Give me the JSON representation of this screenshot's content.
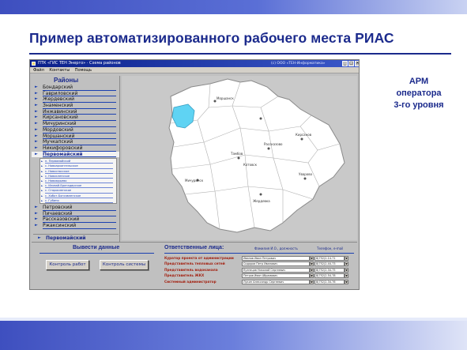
{
  "slide": {
    "title": "Пример автоматизированного рабочего места РИАС",
    "side_note": [
      "АРМ",
      "оператора",
      "3-го уровня"
    ]
  },
  "window": {
    "title": "ПТК «ГИС ТЕН Энерго» · Схема районов",
    "title_right": "(c) ООО «ТЕН-Информатика»",
    "menu": [
      "Файл",
      "Контакты",
      "Помощь"
    ]
  },
  "districts": {
    "heading": "Районы",
    "items": [
      "Бондарский",
      "Гавриловский",
      "Жердевский",
      "Знаменский",
      "Инжавинский",
      "Кирсановский",
      "Мичуринский",
      "Мордовский",
      "Моршанский",
      "Мучкапский",
      "Никифоровский",
      "Первомайский"
    ],
    "selected_index": 11,
    "sub_items": [
      "п. Первомайский",
      "с. Новоархангельское",
      "с. Новоспасское",
      "с. Новокленское",
      "с. Новоюрьево",
      "с. Иловай-Бригадирское",
      "с. Старокленское",
      "с. Хобот-Богоявленское",
      "с. Губино"
    ],
    "items_after": [
      "Петровский",
      "Пичаевский",
      "Рассказовский",
      "Ржаксинский"
    ],
    "current": "Первомайский"
  },
  "map": {
    "labels": [
      "Моршанск",
      "Мичуринск",
      "Тамбов",
      "Котовск",
      "Рассказово",
      "Уварово",
      "Кирсанов",
      "Жердевка"
    ],
    "highlight_color": "#5fd3f3",
    "fill_color": "#ffffff",
    "border_color": "#8a8a8a",
    "background_color": "#c9c9c9"
  },
  "output": {
    "title": "Вывести данные",
    "btn_work": "Контроль работ",
    "btn_system": "Контроль системы"
  },
  "responsible": {
    "title": "Ответственные лица:",
    "col_fio": "Фамилия И.О., должность",
    "col_tel": "Телефон, e-mail",
    "rows": [
      {
        "role": "Куратор проекта от администрации",
        "name": "Иванов Иван Петрович",
        "phone": "8(752)2-14-71"
      },
      {
        "role": "Представитель тепловых сетей",
        "name": "Сидоров Петр Иванович",
        "phone": "8(752)2-44-73"
      },
      {
        "role": "Представитель водоканала",
        "name": "Кузнецов Николай Сергеевич",
        "phone": "8(752)2-34-75"
      },
      {
        "role": "Представитель ЖКХ",
        "name": "Петров Иван Абрамович",
        "phone": "8(752)2-54-78"
      },
      {
        "role": "Системный администратор",
        "name": "Лукин Александр Сергеевич",
        "phone": "8(752)2-34-76"
      }
    ]
  }
}
